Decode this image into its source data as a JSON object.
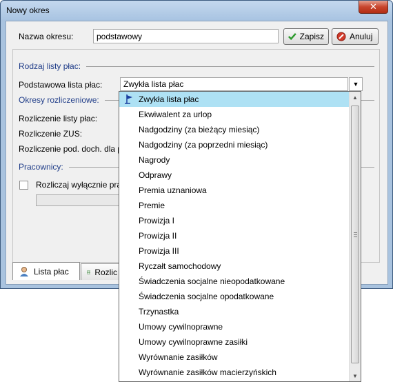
{
  "window": {
    "title": "Nowy okres",
    "close_label": "✕"
  },
  "form": {
    "name_label": "Nazwa okresu:",
    "name_value": "podstawowy",
    "save_label": "Zapisz",
    "cancel_label": "Anuluj"
  },
  "sections": {
    "payroll_type": "Rodzaj listy płac:",
    "base_payroll_label": "Podstawowa lista płac:",
    "base_payroll_value": "Zwykła lista płac",
    "settlement_periods": "Okresy rozliczeniowe:",
    "settle_payroll": "Rozliczenie listy płac:",
    "settle_zus": "Rozliczenie ZUS:",
    "settle_tax": "Rozliczenie pod. doch. dla p",
    "employees": "Pracownicy:",
    "only_checkbox": "Rozliczaj wyłącznie prac"
  },
  "tabs": [
    {
      "label": "Lista płac"
    },
    {
      "label": "Rozlic"
    }
  ],
  "dropdown": {
    "selected_index": 0,
    "items": [
      "Zwykła lista płac",
      "Ekwiwalent za urlop",
      "Nadgodziny (za bieżący miesiąc)",
      "Nadgodziny (za poprzedni miesiąc)",
      "Nagrody",
      "Odprawy",
      "Premia uznaniowa",
      "Premie",
      "Prowizja I",
      "Prowizja II",
      "Prowizja III",
      "Ryczałt samochodowy",
      "Świadczenia socjalne nieopodatkowane",
      "Świadczenia socjalne opodatkowane",
      "Trzynastka",
      "Umowy cywilnoprawne",
      "Umowy cywilnoprawne zasiłki",
      "Wyrównanie zasiłków",
      "Wyrównanie zasiłków macierzyńskich"
    ]
  },
  "colors": {
    "accent_selected": "#aee1f4",
    "section_text": "#1f3c88",
    "save_check": "#2e9b2e",
    "cancel_red": "#d23a2a"
  }
}
